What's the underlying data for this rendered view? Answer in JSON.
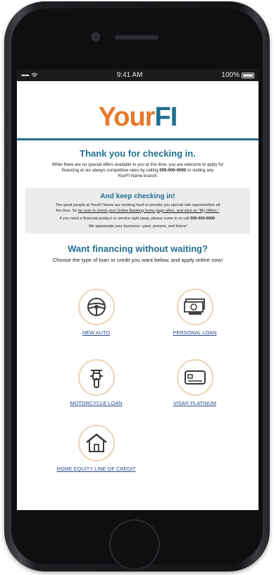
{
  "status_bar": {
    "signal": "•••••",
    "time": "9:41 AM",
    "battery_pct": "100%"
  },
  "logo": {
    "part1": "Your",
    "part2": "FI"
  },
  "thanks": {
    "title": "Thank you for checking in.",
    "line1": "While there are no special offers available to you at this time, you are welcome to apply for",
    "line2_prefix": "financing at our always competitive rates by calling ",
    "phone": "000-000-0000",
    "line2_suffix": " or visiting any",
    "line3": "YourFI Name branch."
  },
  "keep": {
    "title": "And keep checking in!",
    "line1": "The good people at YourFI Name are working hard to provide you special rate opportunities all",
    "line2_prefix": "the time. So ",
    "line2_link": "be sure to check your Online Banking home page often, and click on \"My Offers.\"",
    "line3_prefix": "If you need a financial product or service right away, please come in or call ",
    "phone": "000-000-0000",
    "line3_suffix": ".",
    "line4": "We appreciate your business—past, present, and future!"
  },
  "want": {
    "title": "Want financing without waiting?",
    "subtitle": "Choose the type of loan or credit you want below, and apply online now!"
  },
  "options": [
    {
      "label": "NEW AUTO",
      "icon": "steering-wheel-icon"
    },
    {
      "label": "PERSONAL LOAN",
      "icon": "cash-icon"
    },
    {
      "label": "MOTORCYCLE LOAN",
      "icon": "motorcycle-icon"
    },
    {
      "label": "VISA® PLATINUM",
      "icon": "credit-card-icon"
    },
    {
      "label": "HOME EQUITY LINE OF CREDIT",
      "icon": "house-icon"
    }
  ],
  "colors": {
    "brand_orange": "#e57a2c",
    "brand_teal": "#1f6e8f",
    "link_blue": "#2a4a8a"
  }
}
